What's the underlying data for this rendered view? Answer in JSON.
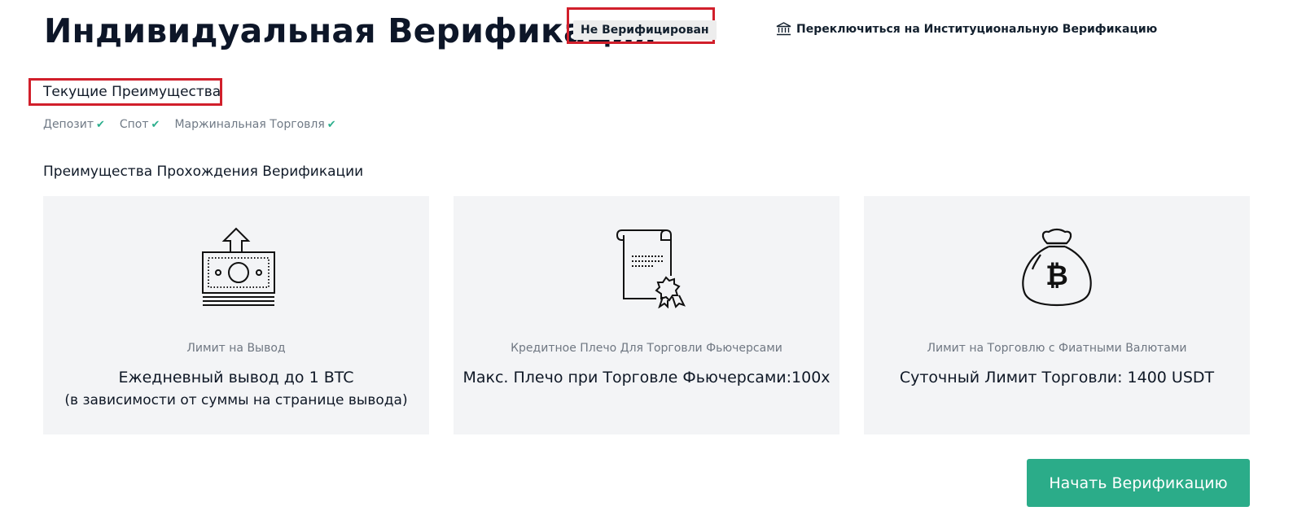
{
  "header": {
    "title": "Индивидуальная Верификация",
    "status_badge": "Не Верифицирован",
    "switch_link": "Переключиться на Институциональную Верификацию",
    "switch_icon": "bank-icon"
  },
  "current_benefits": {
    "title": "Текущие Преимущества",
    "items": [
      {
        "label": "Депозит"
      },
      {
        "label": "Спот"
      },
      {
        "label": "Маржинальная Торговля"
      }
    ]
  },
  "verification_benefits": {
    "title": "Преимущества Прохождения Верификации",
    "cards": [
      {
        "icon": "withdraw-money-icon",
        "label": "Лимит на Вывод",
        "value": "Ежедневный вывод до 1 BTC",
        "note": "(в зависимости от суммы на странице вывода)"
      },
      {
        "icon": "certificate-icon",
        "label": "Кредитное Плечо Для Торговли Фьючерсами",
        "value": "Макс. Плечо при Торговле Фьючерсами:100x",
        "note": ""
      },
      {
        "icon": "bitcoin-bag-icon",
        "label": "Лимит на Торговлю с Фиатными Валютами",
        "value": "Суточный Лимит Торговли: 1400 USDT",
        "note": ""
      }
    ]
  },
  "actions": {
    "start_label": "Начать Верификацию"
  },
  "colors": {
    "accent": "#2bac89",
    "highlight": "#d11f2b",
    "card_bg": "#f3f4f6"
  }
}
